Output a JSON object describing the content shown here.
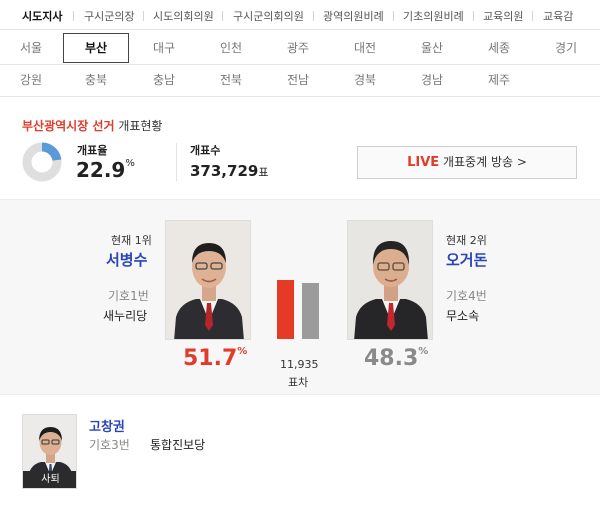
{
  "top_nav": {
    "items": [
      "시도지사",
      "구시군의장",
      "시도의회의원",
      "구시군의회의원",
      "광역의원비례",
      "기초의원비례",
      "교육의원",
      "교육감"
    ],
    "active": "시도지사"
  },
  "regions": {
    "row1": [
      "서울",
      "부산",
      "대구",
      "인천",
      "광주",
      "대전",
      "울산",
      "세종",
      "경기"
    ],
    "row2": [
      "강원",
      "충북",
      "충남",
      "전북",
      "전남",
      "경북",
      "경남",
      "제주"
    ],
    "active": "부산"
  },
  "election": {
    "title_red": "부산광역시장 선거",
    "title_rest": " 개표현황",
    "turnout_label": "개표율",
    "turnout_value": "22.9",
    "turnout_unit": "%",
    "turnout_pct": 22.9,
    "count_label": "개표수",
    "count_value": "373,729",
    "count_unit": "표",
    "live_label": "LIVE",
    "live_text": " 개표중계 방송 >"
  },
  "candidates": [
    {
      "rank": "현재 1위",
      "name": "서병수",
      "kiho": "기호1번",
      "party": "새누리당",
      "pct": "51.7",
      "pct_unit": "%"
    },
    {
      "rank": "현재 2위",
      "name": "오거돈",
      "kiho": "기호4번",
      "party": "무소속",
      "pct": "48.3",
      "pct_unit": "%"
    }
  ],
  "diff": {
    "value": "11,935",
    "label": "표차"
  },
  "withdrawn": {
    "name": "고창권",
    "kiho": "기호3번",
    "party": "통합진보당",
    "badge": "사퇴"
  },
  "colors": {
    "accent_red": "#e03c2b",
    "name_blue": "#2a45b8",
    "bar_red": "#e43a26",
    "bar_gray": "#9b9b9b",
    "donut_blue": "#5a9ad8"
  }
}
